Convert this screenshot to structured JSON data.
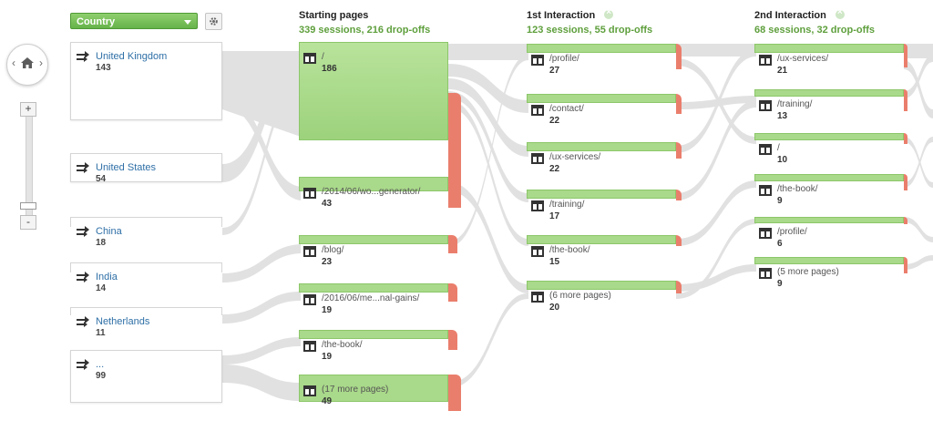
{
  "country_selector": {
    "label": "Country"
  },
  "columns": [
    {
      "title": "Starting pages",
      "subtitle": "339 sessions, 216 drop-offs"
    },
    {
      "title": "1st Interaction",
      "subtitle": "123 sessions, 55 drop-offs"
    },
    {
      "title": "2nd Interaction",
      "subtitle": "68 sessions, 32 drop-offs"
    }
  ],
  "countries": [
    {
      "name": "United Kingdom",
      "count": "143"
    },
    {
      "name": "United States",
      "count": "54"
    },
    {
      "name": "China",
      "count": "18"
    },
    {
      "name": "India",
      "count": "14"
    },
    {
      "name": "Netherlands",
      "count": "11"
    },
    {
      "name": "...",
      "count": "99"
    }
  ],
  "starting_pages": [
    {
      "name": "/",
      "count": "186"
    },
    {
      "name": "/2014/06/wo...generator/",
      "count": "43"
    },
    {
      "name": "/blog/",
      "count": "23"
    },
    {
      "name": "/2016/06/me...nal-gains/",
      "count": "19"
    },
    {
      "name": "/the-book/",
      "count": "19"
    },
    {
      "name": "(17 more pages)",
      "count": "49"
    }
  ],
  "first_interaction": [
    {
      "name": "/profile/",
      "count": "27"
    },
    {
      "name": "/contact/",
      "count": "22"
    },
    {
      "name": "/ux-services/",
      "count": "22"
    },
    {
      "name": "/training/",
      "count": "17"
    },
    {
      "name": "/the-book/",
      "count": "15"
    },
    {
      "name": "(6 more pages)",
      "count": "20"
    }
  ],
  "second_interaction": [
    {
      "name": "/ux-services/",
      "count": "21"
    },
    {
      "name": "/training/",
      "count": "13"
    },
    {
      "name": "/",
      "count": "10"
    },
    {
      "name": "/the-book/",
      "count": "9"
    },
    {
      "name": "/profile/",
      "count": "6"
    },
    {
      "name": "(5 more pages)",
      "count": "9"
    }
  ],
  "colors": {
    "node_green": "#a9d98a",
    "dropoff_red": "#ea7e6c",
    "flow_gray": "#dcdcdc",
    "header_green": "#5e9f3c"
  },
  "icons": {
    "country_node": "arrows-icon",
    "page_node": "page-icon",
    "home": "home-icon",
    "settings": "gear-icon",
    "remove_step": "close-icon"
  }
}
